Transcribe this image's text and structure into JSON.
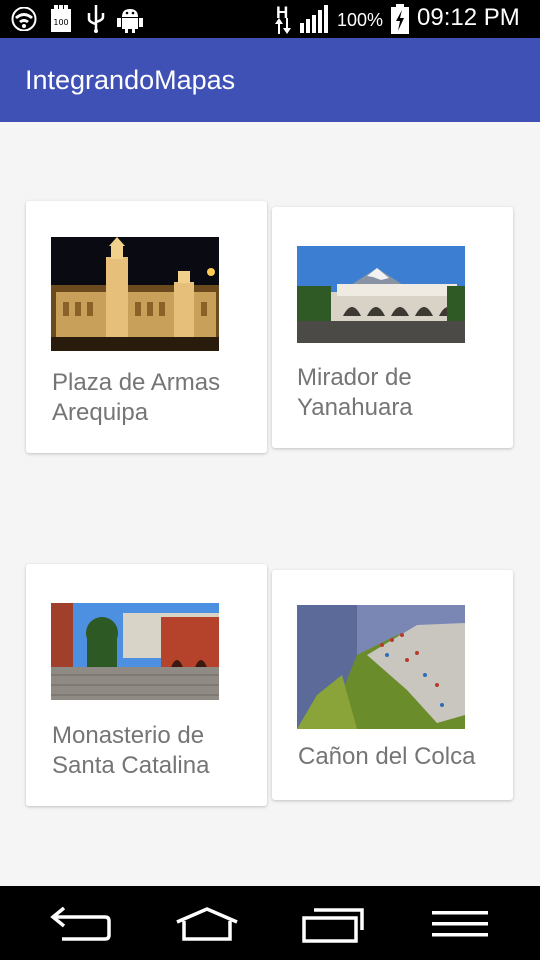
{
  "status_bar": {
    "battery_percent": "100%",
    "time": "09:12 PM",
    "network_type": "H",
    "icons": [
      "wifi-icon",
      "storage-100-icon",
      "usb-icon",
      "android-debug-icon",
      "data-transfer-icon",
      "signal-icon",
      "battery-charging-icon"
    ]
  },
  "app_bar": {
    "title": "IntegrandoMapas",
    "color": "#3f51b5"
  },
  "places": [
    {
      "title_line1": "Plaza de Armas",
      "title_line2": "Arequipa"
    },
    {
      "title_line1": "Mirador de",
      "title_line2": "Yanahuara"
    },
    {
      "title_line1": "Monasterio de",
      "title_line2": "Santa Catalina"
    },
    {
      "title_line1": "Cañon del Colca"
    }
  ],
  "nav_bar": {
    "icons": [
      "back-icon",
      "home-icon",
      "recent-apps-icon",
      "menu-icon"
    ]
  }
}
